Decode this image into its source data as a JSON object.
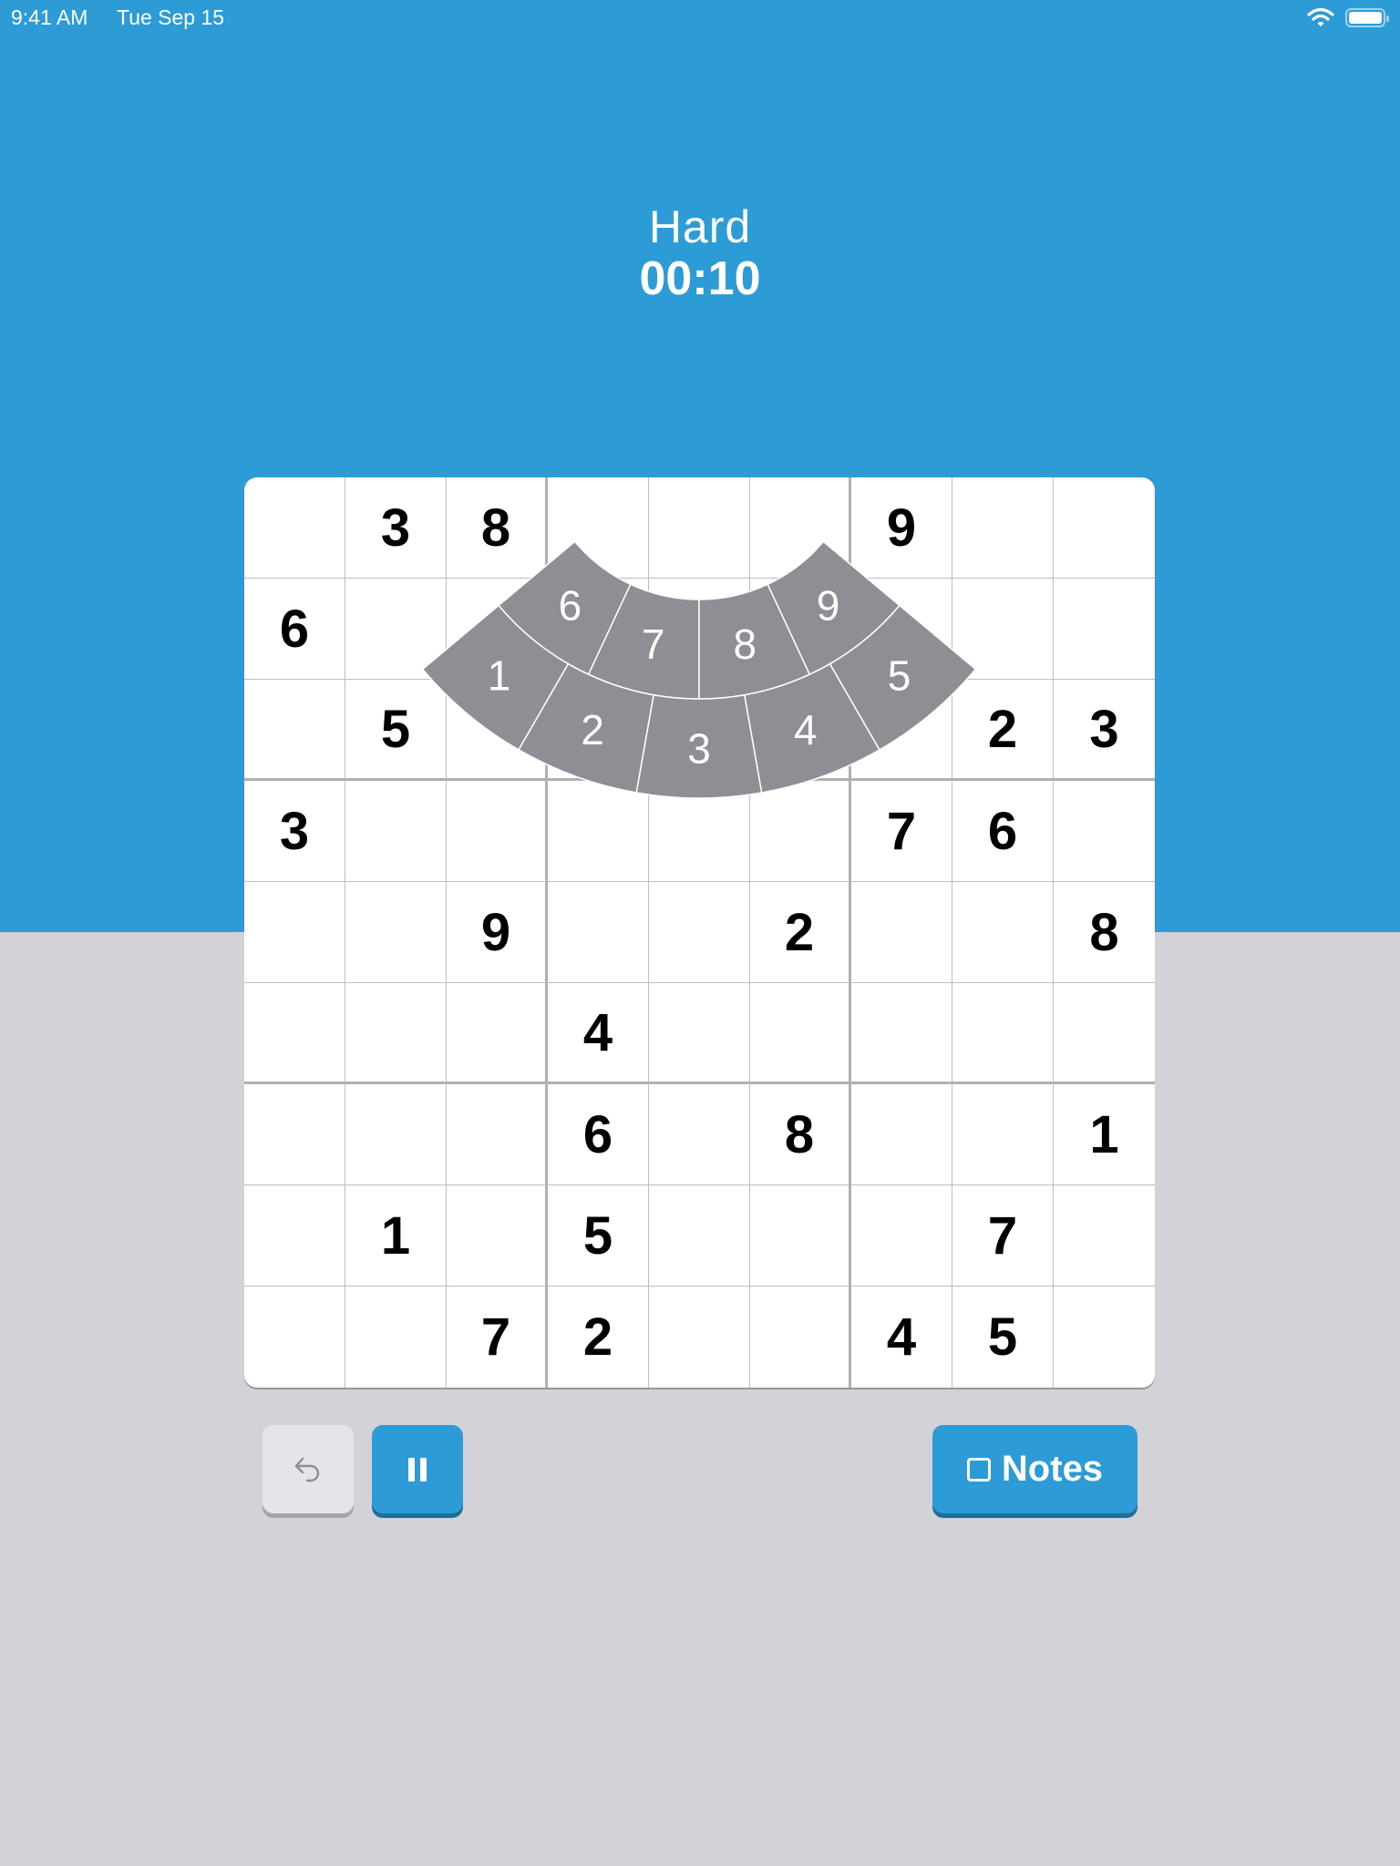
{
  "status_bar": {
    "time": "9:41 AM",
    "date": "Tue Sep 15",
    "icons": [
      "wifi-icon",
      "battery-icon"
    ]
  },
  "header": {
    "difficulty": "Hard",
    "timer": "00:10"
  },
  "board": {
    "rows": [
      [
        "",
        "3",
        "8",
        "",
        "",
        "",
        "9",
        "",
        ""
      ],
      [
        "6",
        "",
        "",
        "",
        "",
        "",
        "",
        "",
        ""
      ],
      [
        "",
        "5",
        "",
        "",
        "",
        "",
        "",
        "2",
        "3"
      ],
      [
        "3",
        "",
        "",
        "",
        "",
        "",
        "7",
        "6",
        ""
      ],
      [
        "",
        "",
        "9",
        "",
        "",
        "2",
        "",
        "",
        "8"
      ],
      [
        "",
        "",
        "",
        "4",
        "",
        "",
        "",
        "",
        ""
      ],
      [
        "",
        "",
        "",
        "6",
        "",
        "8",
        "",
        "",
        "1"
      ],
      [
        "",
        "1",
        "",
        "5",
        "",
        "",
        "",
        "7",
        ""
      ],
      [
        "",
        "",
        "7",
        "2",
        "",
        "",
        "4",
        "5",
        ""
      ]
    ]
  },
  "number_picker": {
    "inner_ring": [
      "6",
      "7",
      "8",
      "9"
    ],
    "outer_ring": [
      "1",
      "2",
      "3",
      "4",
      "5"
    ]
  },
  "controls": {
    "undo_icon": "undo-arrow-icon",
    "pause_icon": "pause-icon",
    "notes_label": "Notes",
    "notes_checked": false
  },
  "colors": {
    "accent": "#2d9cd6",
    "background": "#d2d2d8",
    "picker_fill": "#8f8e94",
    "undo_bg": "#e4e4ea"
  }
}
